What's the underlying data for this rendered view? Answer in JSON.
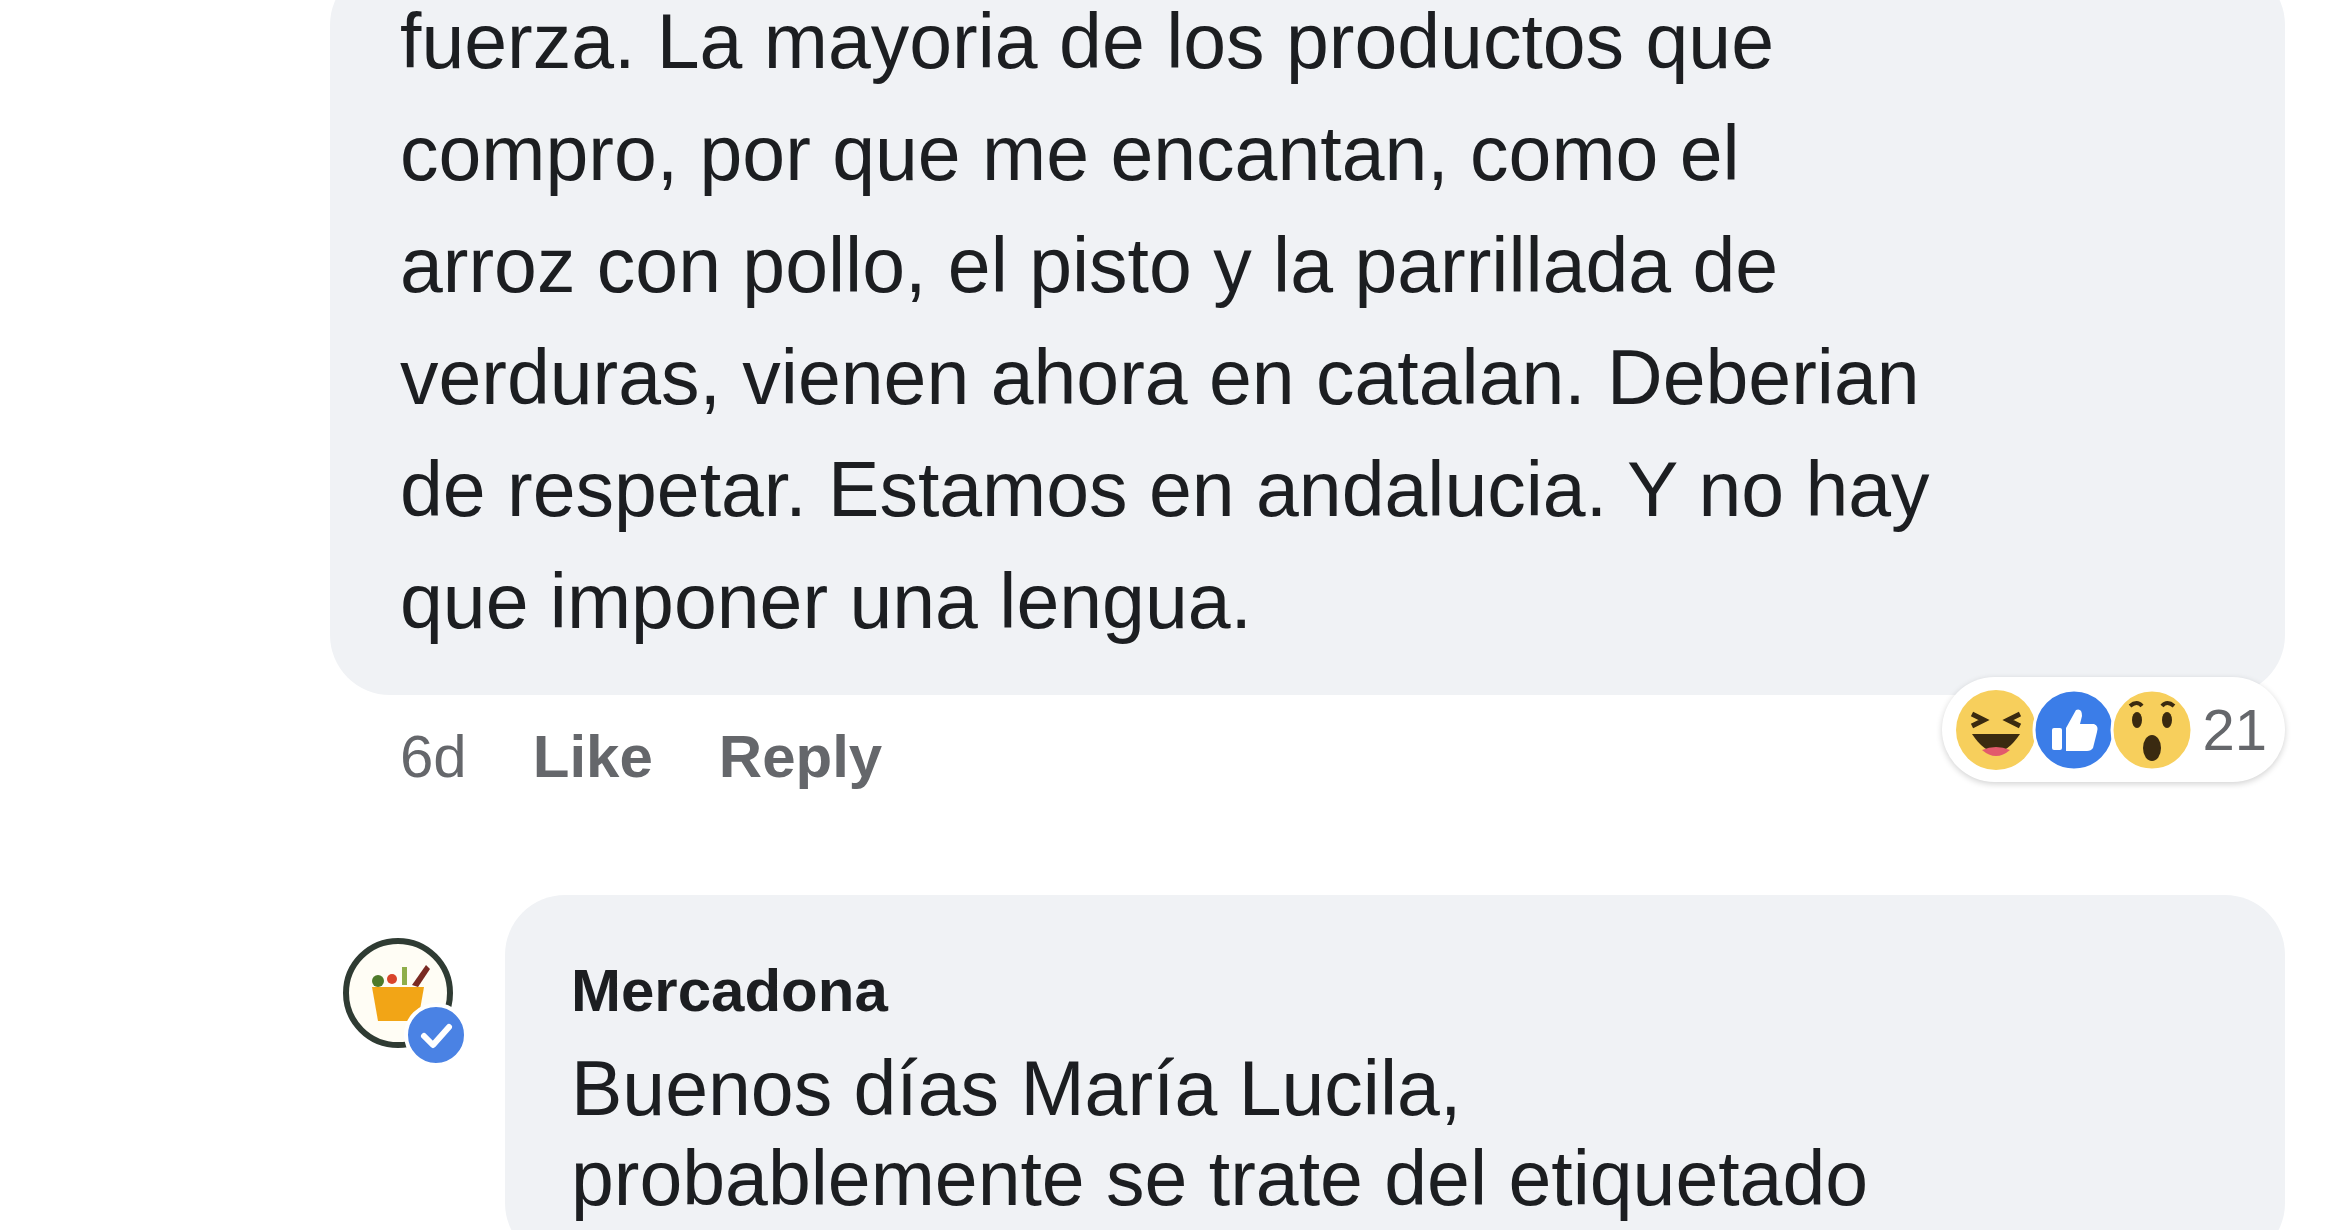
{
  "comment": {
    "text": "fuerza. La mayoria de los productos que\ncompro, por que me encantan, como el\narroz con pollo, el pisto y la parrillada de\nverduras, vienen ahora en catalan. Deberian\nde respetar. Estamos en andalucia. Y no hay\nque imponer una lengua.",
    "time": "6d",
    "actions": [
      "Like",
      "Reply"
    ],
    "reactions": {
      "types": [
        {
          "kind": "haha"
        },
        {
          "kind": "like"
        },
        {
          "kind": "wow"
        }
      ],
      "count": "21"
    }
  },
  "reply": {
    "author": "Mercadona",
    "verified": true,
    "text": "Buenos días María Lucila,\nprobablemente se trate del etiquetado"
  }
}
